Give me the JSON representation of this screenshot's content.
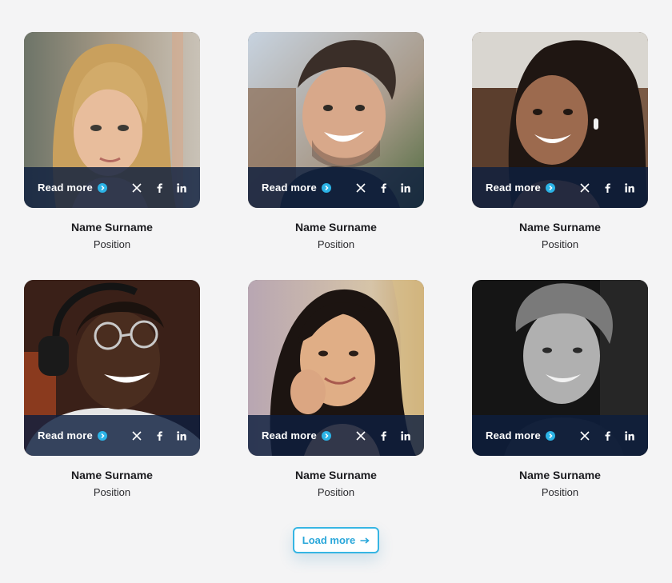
{
  "team": [
    {
      "name": "Name Surname",
      "position": "Position",
      "read_more": "Read more",
      "photo": "blonde-woman-portrait"
    },
    {
      "name": "Name Surname",
      "position": "Position",
      "read_more": "Read more",
      "photo": "smiling-man-portrait"
    },
    {
      "name": "Name Surname",
      "position": "Position",
      "read_more": "Read more",
      "photo": "smiling-woman-curly-hair-portrait"
    },
    {
      "name": "Name Surname",
      "position": "Position",
      "read_more": "Read more",
      "photo": "man-with-headphones-glasses-portrait"
    },
    {
      "name": "Name Surname",
      "position": "Position",
      "read_more": "Read more",
      "photo": "woman-hand-on-cheek-portrait"
    },
    {
      "name": "Name Surname",
      "position": "Position",
      "read_more": "Read more",
      "photo": "black-and-white-man-portrait"
    }
  ],
  "socials": [
    "x-icon",
    "facebook-icon",
    "linkedin-icon"
  ],
  "load_more": {
    "label": "Load more"
  },
  "colors": {
    "accent": "#2bb3e6",
    "overlay": "#0d1e3e",
    "background": "#f4f4f5",
    "text": "#1b1b1f"
  }
}
